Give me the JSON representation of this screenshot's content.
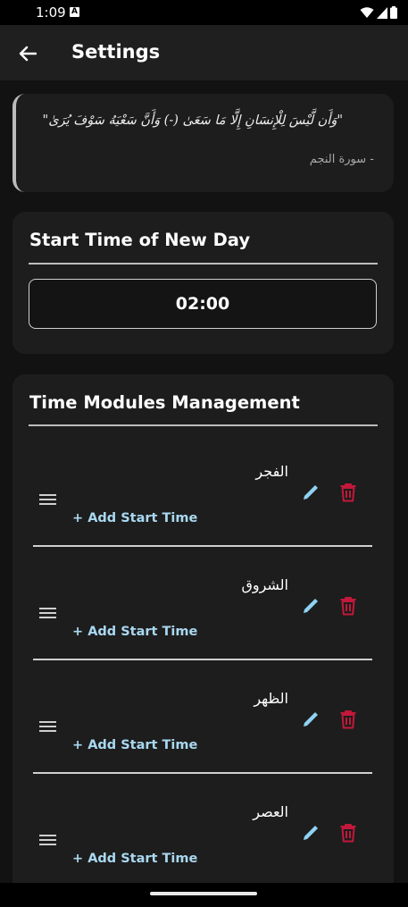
{
  "status_bar": {
    "time": "1:09",
    "notification_badge": "A"
  },
  "app_bar": {
    "title": "Settings",
    "back_icon": "arrow-left-icon"
  },
  "quote": {
    "text": "\"وَأَن لَّيْسَ لِلْإِنسَانِ إِلَّا مَا سَعَىٰ (-) وَأَنَّ سَعْيَهُ سَوْفَ يُرَىٰ\"",
    "source": "- سورة النجم"
  },
  "start_time": {
    "title": "Start Time of New Day",
    "value": "02:00"
  },
  "modules": {
    "title": "Time Modules Management",
    "items": [
      {
        "name": "الفجر",
        "add_label": "+ Add Start Time"
      },
      {
        "name": "الشروق",
        "add_label": "+ Add Start Time"
      },
      {
        "name": "الظهر",
        "add_label": "+ Add Start Time"
      },
      {
        "name": "العصر",
        "add_label": "+ Add Start Time"
      }
    ]
  },
  "colors": {
    "background": "#121212",
    "card": "#1d1d1d",
    "accent_link": "#a9d8f0",
    "edit_icon": "#8fd3f4",
    "delete_icon": "#c2183a"
  },
  "icons": {
    "drag": "drag-handle-icon",
    "edit": "pencil-icon",
    "delete": "trash-icon"
  }
}
